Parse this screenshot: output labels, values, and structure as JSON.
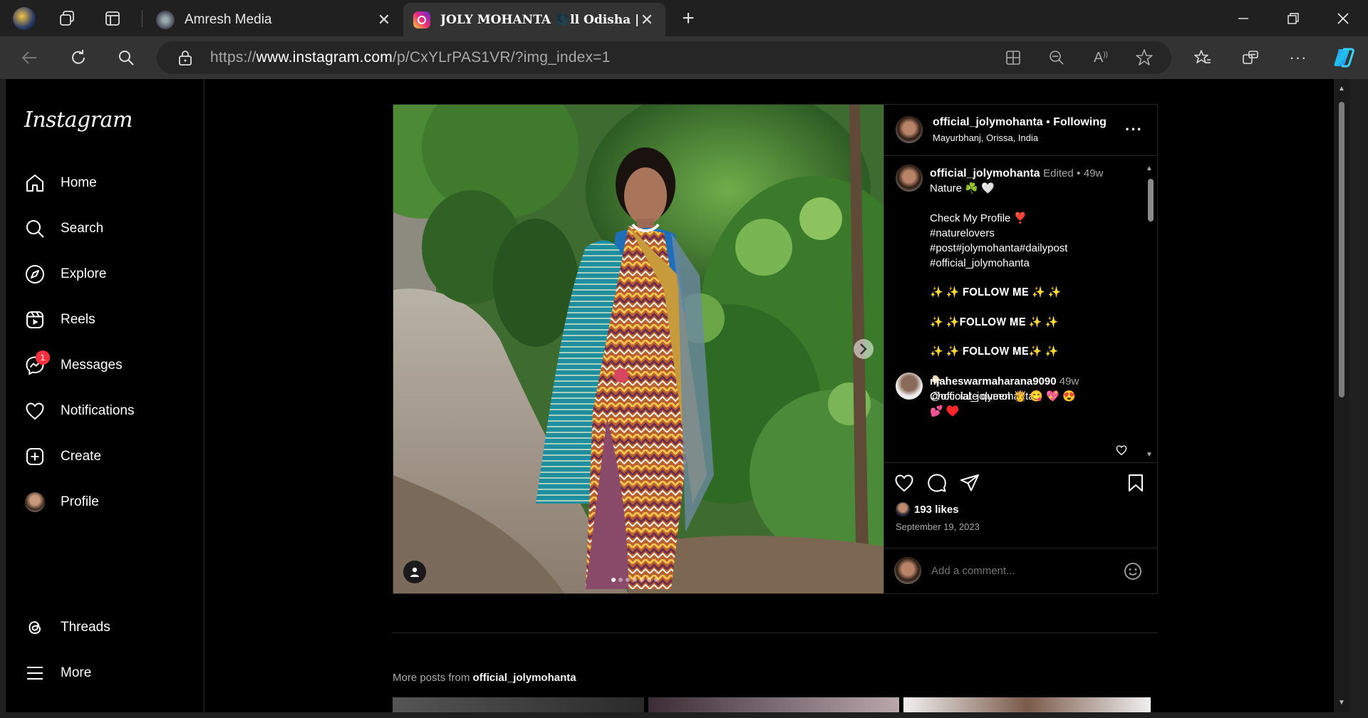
{
  "browser": {
    "tabs": [
      {
        "title": "Amresh Media"
      },
      {
        "title": "JOLY MOHANTA 🌑ll Odisha | Na"
      }
    ],
    "url_prefix": "https://",
    "url_host": "www.instagram.com",
    "url_path": "/p/CxYLrPAS1VR/?img_index=1"
  },
  "sidebar": {
    "logo": "Instagram",
    "items": [
      {
        "label": "Home",
        "icon": "home-icon"
      },
      {
        "label": "Search",
        "icon": "search-icon"
      },
      {
        "label": "Explore",
        "icon": "compass-icon"
      },
      {
        "label": "Reels",
        "icon": "reels-icon"
      },
      {
        "label": "Messages",
        "icon": "messenger-icon",
        "badge": "1"
      },
      {
        "label": "Notifications",
        "icon": "heart-icon"
      },
      {
        "label": "Create",
        "icon": "plus-square-icon"
      },
      {
        "label": "Profile",
        "icon": "avatar"
      }
    ],
    "bottom": [
      {
        "label": "Threads",
        "icon": "threads-icon"
      },
      {
        "label": "More",
        "icon": "menu-icon"
      }
    ]
  },
  "post": {
    "author": "official_jolymohanta",
    "follow_sep": "•",
    "follow_state": "Following",
    "location": "Mayurbhanj, Orissa, India",
    "caption": {
      "author": "official_jolymohanta",
      "edited": "Edited",
      "sep": "•",
      "age": "49w",
      "lines": [
        "Nature ☘️ 🤍",
        "",
        "Check My Profile ❣️",
        "#naturelovers",
        "#post#jolymohanta#dailypost",
        "#official_jolymohanta",
        "",
        "✨ ✨ 𝐅𝐎𝐋𝐋𝐎𝐖 𝐌𝐄 ✨ ✨",
        "",
        "✨ ✨𝐅𝐎𝐋𝐋𝐎𝐖 𝐌𝐄 ✨ ✨",
        "",
        "✨ ✨ 𝐅𝐎𝐋𝐋𝐎𝐖 𝐌𝐄✨ ✨",
        "",
        "👇🏻",
        "@official_jolymohanta"
      ]
    },
    "comment": {
      "author": "maheswarmaharana9090",
      "age": "49w",
      "text": "Chocolate queen 👸 😋 💖 😍",
      "text2": "💕 ♥️"
    },
    "likes": "193 likes",
    "date": "September 19, 2023",
    "comment_placeholder": "Add a comment...",
    "carousel_count": 7,
    "carousel_active": 0
  },
  "more_posts": {
    "prefix": "More posts from",
    "author": "official_jolymohanta"
  },
  "colors": {
    "page_bg": "#000000",
    "chrome_bg": "#202020",
    "toolbar_bg": "#333333",
    "badge": "#ff3040"
  }
}
